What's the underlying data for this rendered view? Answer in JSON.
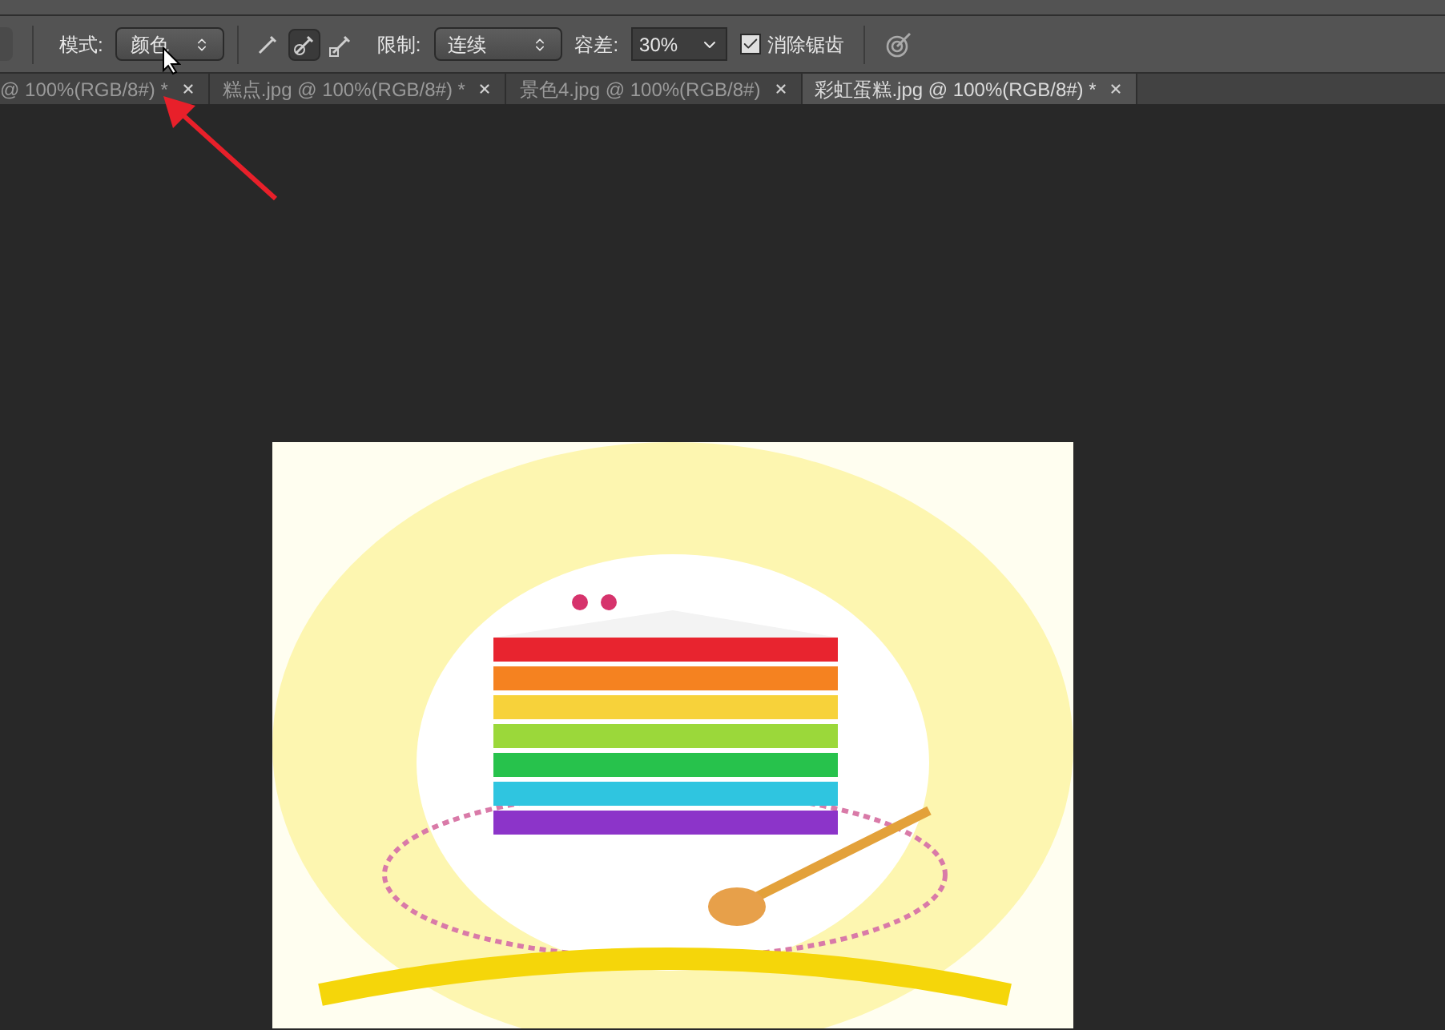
{
  "options_bar": {
    "mode_label": "模式:",
    "mode_value": "颜色",
    "sample_modes": [
      {
        "selected": false
      },
      {
        "selected": true
      },
      {
        "selected": false
      }
    ],
    "limit_label": "限制:",
    "limit_value": "连续",
    "tolerance_label": "容差:",
    "tolerance_value": "30%",
    "antialias": {
      "label": "消除锯齿",
      "checked": true
    }
  },
  "tabs": [
    {
      "label": "@ 100%(RGB/8#) *",
      "selected": false
    },
    {
      "label": "糕点.jpg @ 100%(RGB/8#) *",
      "selected": false
    },
    {
      "label": "景色4.jpg @ 100%(RGB/8#)",
      "selected": false
    },
    {
      "label": "彩虹蛋糕.jpg @ 100%(RGB/8#) *",
      "selected": true
    }
  ]
}
